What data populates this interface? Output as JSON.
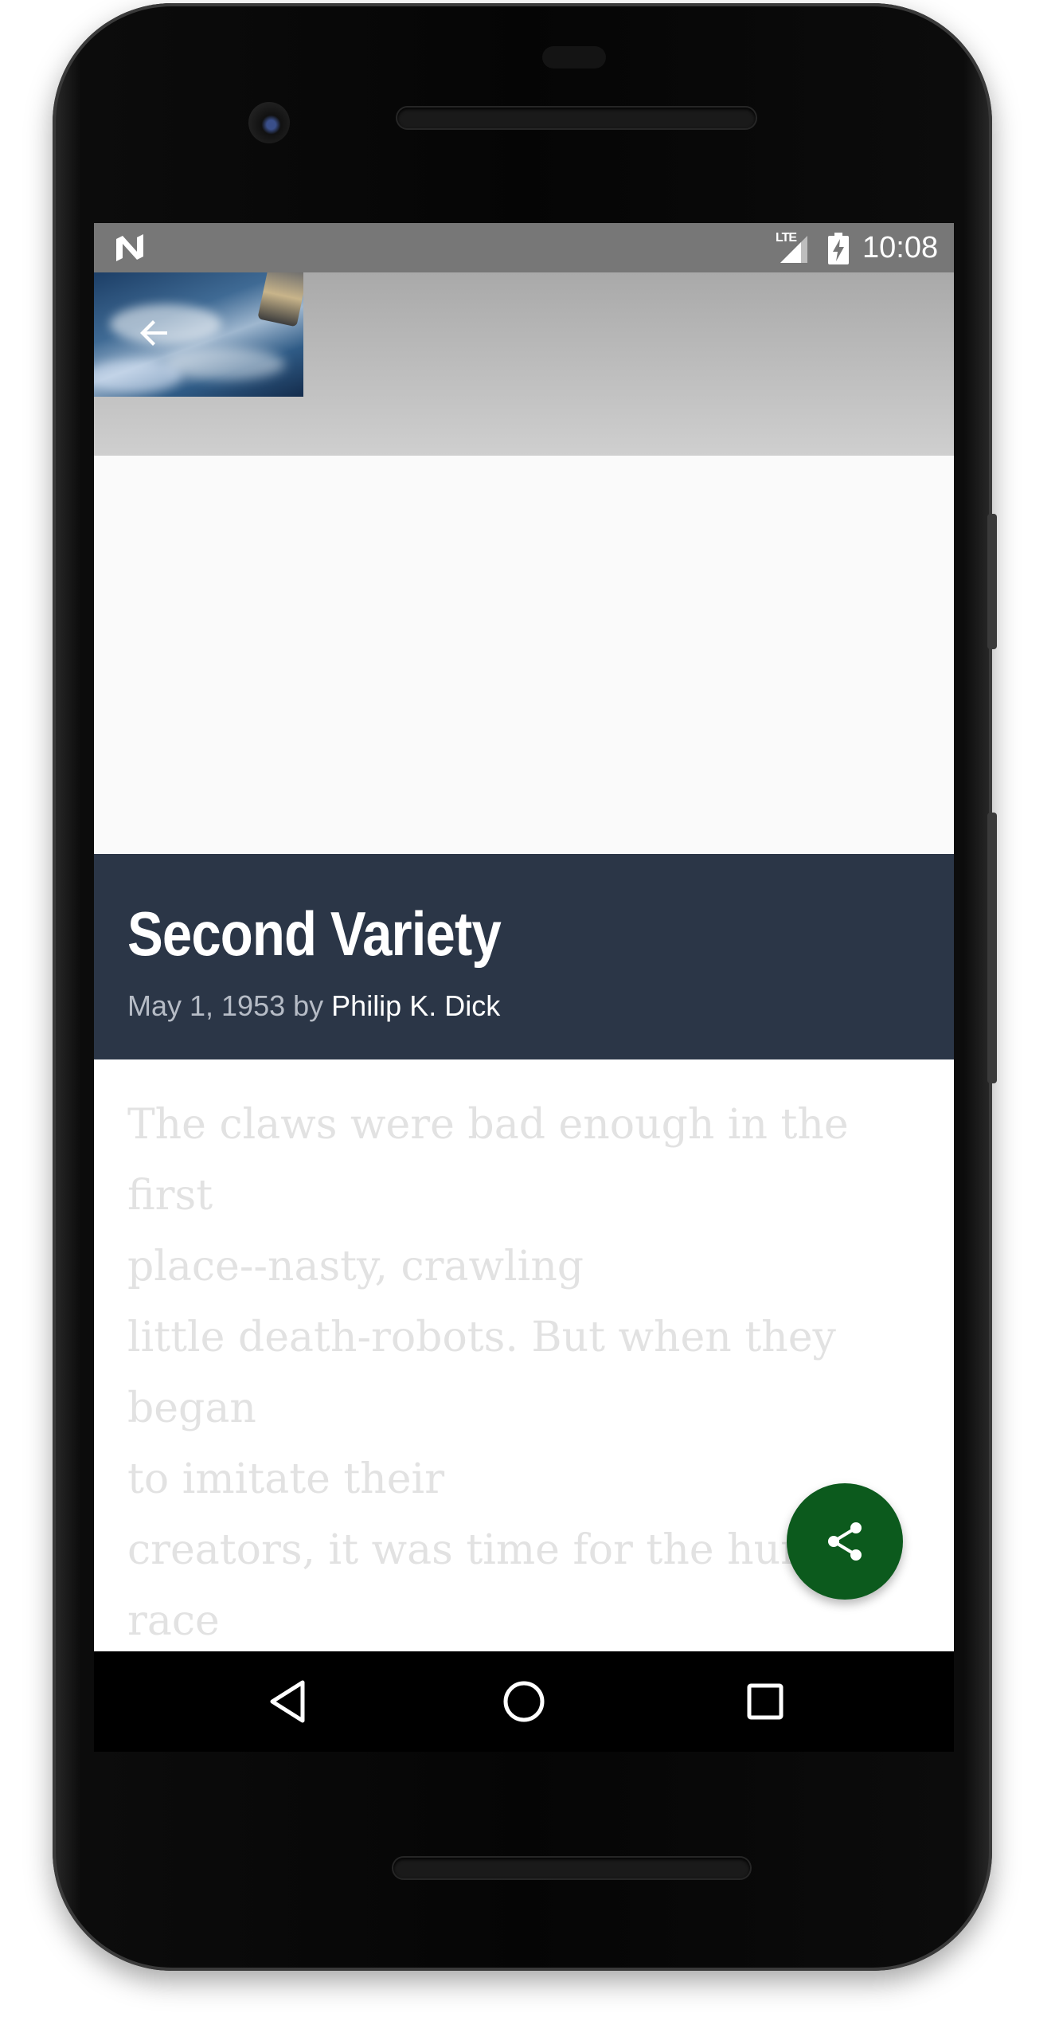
{
  "status_bar": {
    "network": "LTE",
    "time": "10:08",
    "icons": [
      "n-icon",
      "lte-signal-icon",
      "battery-charging-icon"
    ]
  },
  "toolbar": {
    "back_icon": "arrow-back-icon"
  },
  "story": {
    "title": "Second Variety",
    "date_prefix": "May 1, 1953 by ",
    "author": "Philip K. Dick",
    "synopsis": "The claws were bad enough in the first\nplace--nasty, crawling\nlittle death-robots. But when they began\nto imitate their\ncreators, it was time for the human race\nto make peace--if it\ncould!"
  },
  "fab": {
    "icon": "share-icon",
    "color": "#0c5a1d"
  },
  "navigation_bar": {
    "icons": [
      "back-triangle-icon",
      "home-circle-icon",
      "recents-square-icon"
    ]
  },
  "colors": {
    "title_band": "#2b3647",
    "status_bar": "#777777",
    "fab": "#0c5a1d"
  }
}
